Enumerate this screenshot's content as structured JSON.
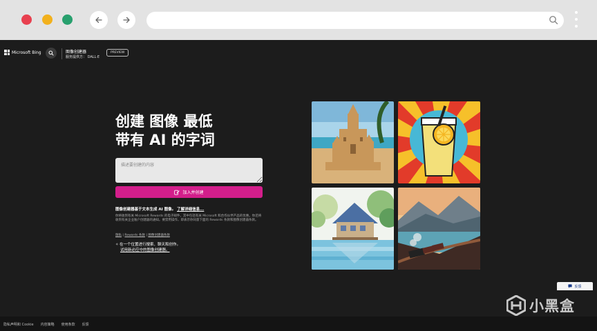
{
  "browser": {
    "address": ""
  },
  "header": {
    "brand": "Microsoft Bing",
    "app_title": "图像创建器",
    "app_subtitle": "服务提供方： DALL·E",
    "preview_badge": "PREVIEW"
  },
  "main": {
    "headline_line1": "创建 图像 最低",
    "headline_line2": "带有 AI 的字词",
    "prompt_placeholder": "描述要创建的内容",
    "create_button": "加入并创建",
    "info_title": "图像创建器基于文本生成 AI 图像。",
    "info_link": "了解详细信息...",
    "info_body": "你将收到有关 Microsoft Rewards 的电子邮件，其中包括有关 Microsoft 和合作伙伴产品的优惠。你还将收到有关企业账户创建器的通知。要禁用操作，即表示你同意下面的 Rewards 条款和图像创建器条款。",
    "link_privacy": "隐私",
    "link_rewards": "Rewards 条款",
    "link_terms": "图像创建器条款",
    "promo_line1": "在一个位置进行搜索、聊天和创作。",
    "promo_line2": "试用新必应中的图像创建器。"
  },
  "footer": {
    "links": [
      "隐私声明和 Cookie",
      "内容策略",
      "使用条款",
      "反馈"
    ],
    "feedback": "反馈"
  },
  "watermark": {
    "text": "小黑盒"
  },
  "colors": {
    "accent": "#d31e8b",
    "page_bg": "#1c1c1c",
    "chrome_bg": "#e3e3e3"
  }
}
